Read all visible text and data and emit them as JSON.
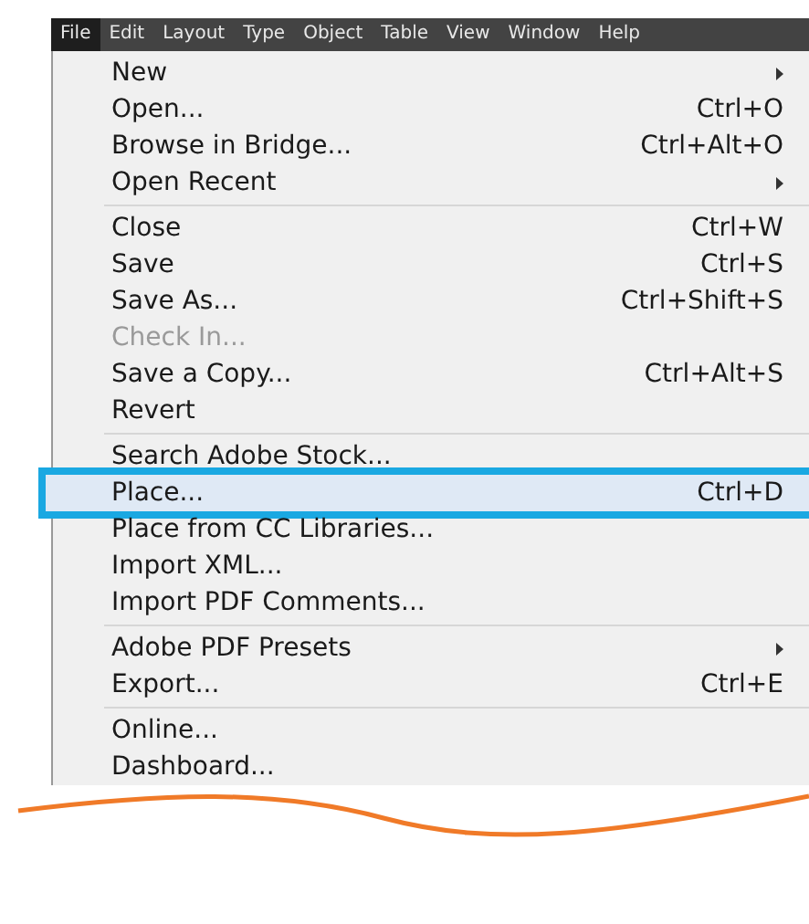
{
  "menubar": [
    {
      "label": "File",
      "selected": true
    },
    {
      "label": "Edit",
      "selected": false
    },
    {
      "label": "Layout",
      "selected": false
    },
    {
      "label": "Type",
      "selected": false
    },
    {
      "label": "Object",
      "selected": false
    },
    {
      "label": "Table",
      "selected": false
    },
    {
      "label": "View",
      "selected": false
    },
    {
      "label": "Window",
      "selected": false
    },
    {
      "label": "Help",
      "selected": false
    }
  ],
  "menu": [
    {
      "kind": "item",
      "label": "New",
      "submenu": true,
      "disabled": false,
      "selected": false
    },
    {
      "kind": "item",
      "label": "Open...",
      "shortcut": "Ctrl+O",
      "disabled": false,
      "selected": false
    },
    {
      "kind": "item",
      "label": "Browse in Bridge...",
      "shortcut": "Ctrl+Alt+O",
      "disabled": false,
      "selected": false
    },
    {
      "kind": "item",
      "label": "Open Recent",
      "submenu": true,
      "disabled": false,
      "selected": false
    },
    {
      "kind": "separator"
    },
    {
      "kind": "item",
      "label": "Close",
      "shortcut": "Ctrl+W",
      "disabled": false,
      "selected": false
    },
    {
      "kind": "item",
      "label": "Save",
      "shortcut": "Ctrl+S",
      "disabled": false,
      "selected": false
    },
    {
      "kind": "item",
      "label": "Save As...",
      "shortcut": "Ctrl+Shift+S",
      "disabled": false,
      "selected": false
    },
    {
      "kind": "item",
      "label": "Check In...",
      "disabled": true,
      "selected": false
    },
    {
      "kind": "item",
      "label": "Save a Copy...",
      "shortcut": "Ctrl+Alt+S",
      "disabled": false,
      "selected": false
    },
    {
      "kind": "item",
      "label": "Revert",
      "disabled": false,
      "selected": false
    },
    {
      "kind": "separator"
    },
    {
      "kind": "item",
      "label": "Search Adobe Stock...",
      "disabled": false,
      "selected": false
    },
    {
      "kind": "item",
      "label": "Place...",
      "shortcut": "Ctrl+D",
      "disabled": false,
      "selected": true
    },
    {
      "kind": "item",
      "label": "Place from CC Libraries...",
      "disabled": false,
      "selected": false
    },
    {
      "kind": "item",
      "label": "Import XML...",
      "disabled": false,
      "selected": false
    },
    {
      "kind": "item",
      "label": "Import PDF Comments...",
      "disabled": false,
      "selected": false
    },
    {
      "kind": "separator"
    },
    {
      "kind": "item",
      "label": "Adobe PDF Presets",
      "submenu": true,
      "disabled": false,
      "selected": false
    },
    {
      "kind": "item",
      "label": "Export...",
      "shortcut": "Ctrl+E",
      "disabled": false,
      "selected": false
    },
    {
      "kind": "separator"
    },
    {
      "kind": "item",
      "label": "Online...",
      "disabled": false,
      "selected": false
    },
    {
      "kind": "item",
      "label": "Dashboard...",
      "disabled": false,
      "selected": false
    }
  ]
}
